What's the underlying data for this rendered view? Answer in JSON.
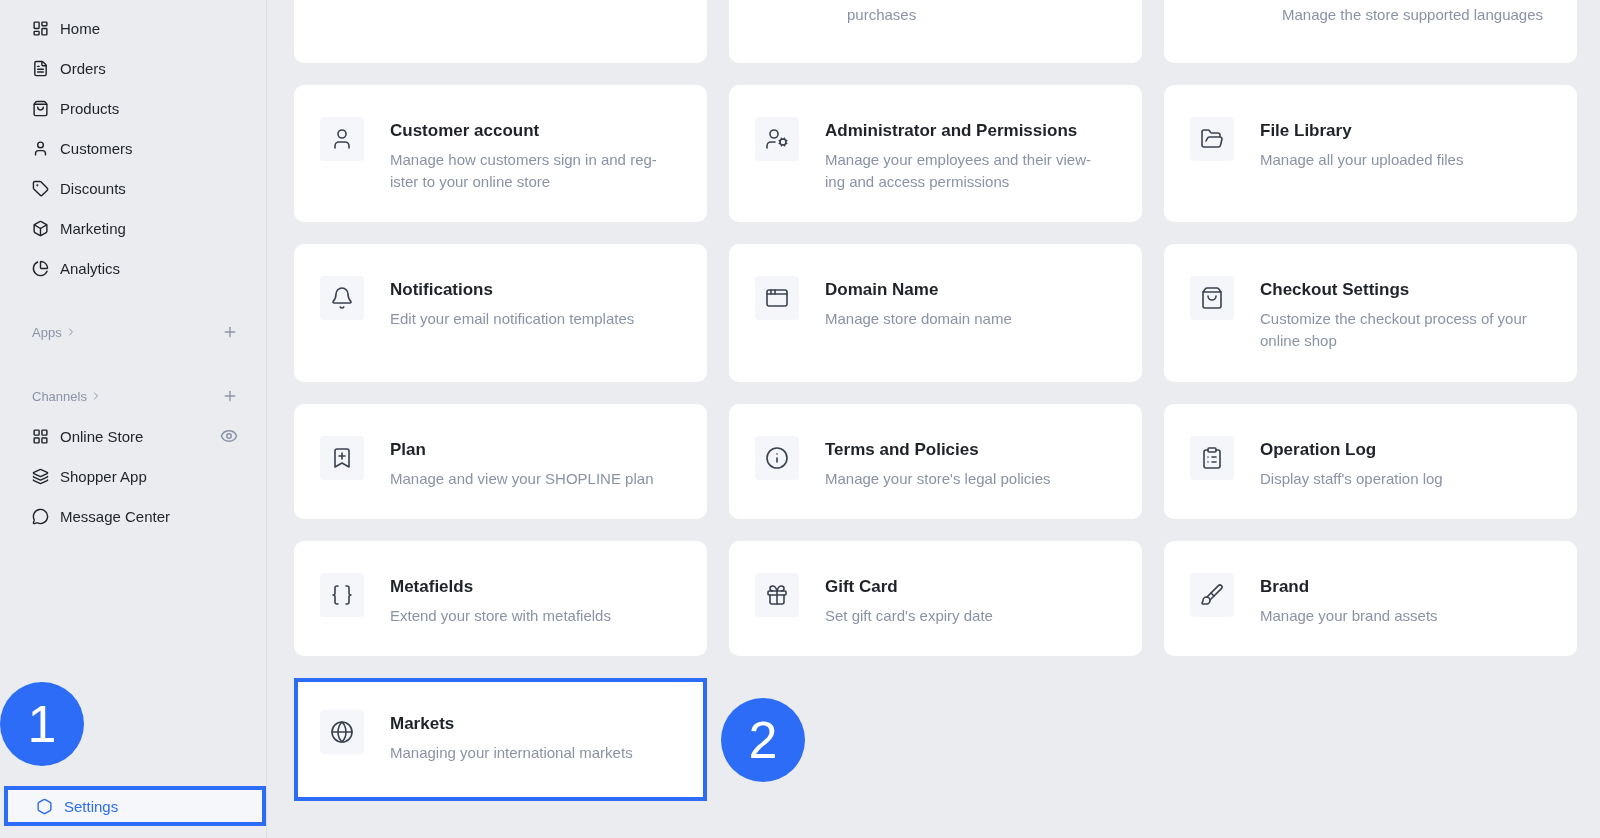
{
  "sidebar": {
    "nav": [
      {
        "label": "Home",
        "selected": false
      },
      {
        "label": "Orders",
        "selected": false
      },
      {
        "label": "Products",
        "selected": false
      },
      {
        "label": "Customers",
        "selected": false
      },
      {
        "label": "Discounts",
        "selected": false
      },
      {
        "label": "Marketing",
        "selected": false
      },
      {
        "label": "Analytics",
        "selected": false
      }
    ],
    "apps_header": "Apps",
    "channels_header": "Channels",
    "channels": [
      {
        "label": "Online Store",
        "selected": false
      },
      {
        "label": "Shopper App",
        "selected": false
      },
      {
        "label": "Message Center",
        "selected": false
      }
    ],
    "settings": {
      "label": "Settings",
      "selected": true,
      "highlighted": true
    }
  },
  "annotations": [
    {
      "label": "1"
    },
    {
      "label": "2"
    }
  ],
  "partial_cards": [
    {
      "highlighted": false
    },
    {
      "description": "purchases",
      "highlighted": false
    },
    {
      "description": "Manage the store supported languages",
      "highlighted": false
    }
  ],
  "cards": [
    {
      "title": "Customer account",
      "description": "Manage how customers sign in and reg-ister to your online store",
      "highlighted": false
    },
    {
      "title": "Administrator and Permissions",
      "description": "Manage your employees and their view-ing and access permissions",
      "highlighted": false
    },
    {
      "title": "File Library",
      "description": "Manage all your uploaded files",
      "highlighted": false
    },
    {
      "title": "Notifications",
      "description": "Edit your email notification templates",
      "highlighted": false
    },
    {
      "title": "Domain Name",
      "description": "Manage store domain name",
      "highlighted": false
    },
    {
      "title": "Checkout Settings",
      "description": "Customize the checkout process of your online shop",
      "highlighted": false
    },
    {
      "title": "Plan",
      "description": "Manage and view your SHOPLINE plan",
      "highlighted": false
    },
    {
      "title": "Terms and Policies",
      "description": "Manage your store's legal policies",
      "highlighted": false
    },
    {
      "title": "Operation Log",
      "description": "Display staff's operation log",
      "highlighted": false
    },
    {
      "title": "Metafields",
      "description": "Extend your store with metafields",
      "highlighted": false
    },
    {
      "title": "Gift Card",
      "description": "Set gift card's expiry date",
      "highlighted": false
    },
    {
      "title": "Brand",
      "description": "Manage your brand assets",
      "highlighted": false
    },
    {
      "title": "Markets",
      "description": "Managing your international markets",
      "highlighted": true
    }
  ]
}
